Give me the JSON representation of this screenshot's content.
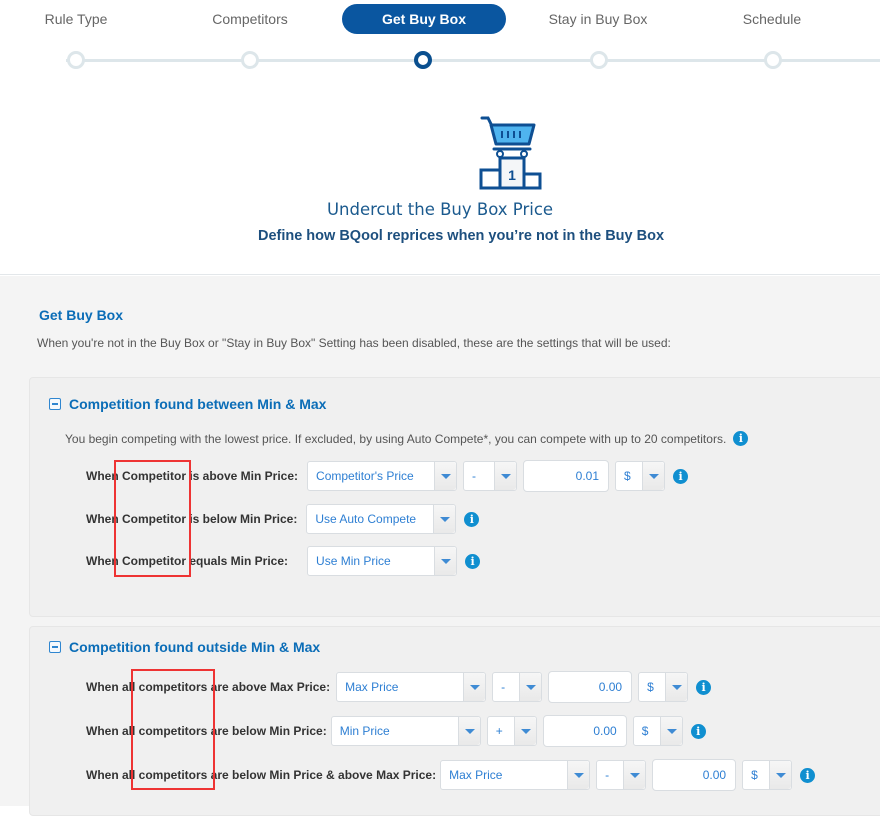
{
  "stepper": {
    "steps": [
      {
        "label": "Rule Type",
        "active": false
      },
      {
        "label": "Competitors",
        "active": false
      },
      {
        "label": "Get Buy Box",
        "active": true
      },
      {
        "label": "Stay in Buy Box",
        "active": false
      },
      {
        "label": "Schedule",
        "active": false
      }
    ]
  },
  "hero": {
    "icon": "cart-podium-first-place-icon",
    "icon_digit": "1",
    "title": "Undercut the Buy Box Price",
    "subtitle": "Define how BQool reprices when you’re not in the Buy Box"
  },
  "section": {
    "title": "Get Buy Box",
    "description": "When you're not in the Buy Box or \"Stay in Buy Box\" Setting has been disabled, these are the settings that will be used:"
  },
  "panel_between": {
    "title": "Competition found between Min & Max",
    "note": "You begin competing with the lowest price. If excluded, by using Auto Compete*, you can compete with up to 20 competitors.",
    "rows": [
      {
        "label": "When Competitor is above Min Price:",
        "strategy": "Competitor's Price",
        "operator": "-",
        "amount": "0.01",
        "unit": "$"
      },
      {
        "label": "When Competitor is below Min Price:",
        "strategy": "Use Auto Compete"
      },
      {
        "label": "When Competitor equals Min Price:",
        "strategy": "Use Min Price"
      }
    ]
  },
  "panel_outside": {
    "title": "Competition found outside Min & Max",
    "rows": [
      {
        "label": "When all competitors are above Max Price:",
        "strategy": "Max Price",
        "operator": "-",
        "amount": "0.00",
        "unit": "$"
      },
      {
        "label": "When all competitors are below Min Price:",
        "strategy": "Min Price",
        "operator": "+",
        "amount": "0.00",
        "unit": "$"
      },
      {
        "label": "When all competitors are below Min Price & above Max Price:",
        "strategy": "Max Price",
        "operator": "-",
        "amount": "0.00",
        "unit": "$"
      }
    ]
  },
  "icons": {
    "info": "i"
  },
  "colors": {
    "brand": "#0a56a0",
    "accent_text": "#0b6db7",
    "value_text": "#2e7fd3",
    "info": "#108fd0",
    "highlight": "#ee3333"
  }
}
